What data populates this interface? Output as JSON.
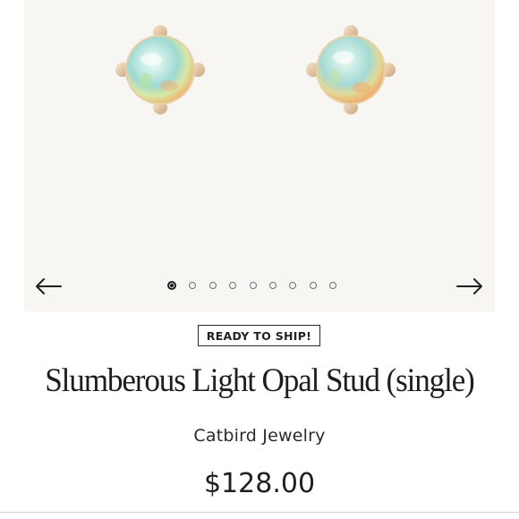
{
  "gallery": {
    "prev_arrow": "←",
    "next_arrow": "→",
    "slide_count": 9,
    "active_slide": 1,
    "background_color": "#f8f6f3"
  },
  "product": {
    "badge": "READY TO SHIP!",
    "title": "Slumberous Light Opal Stud (single)",
    "brand": "Catbird Jewelry",
    "price": "$128.00"
  },
  "colors": {
    "text": "#1e1e1e",
    "gold": "#e8cba4",
    "opal": "#bfe3df"
  }
}
